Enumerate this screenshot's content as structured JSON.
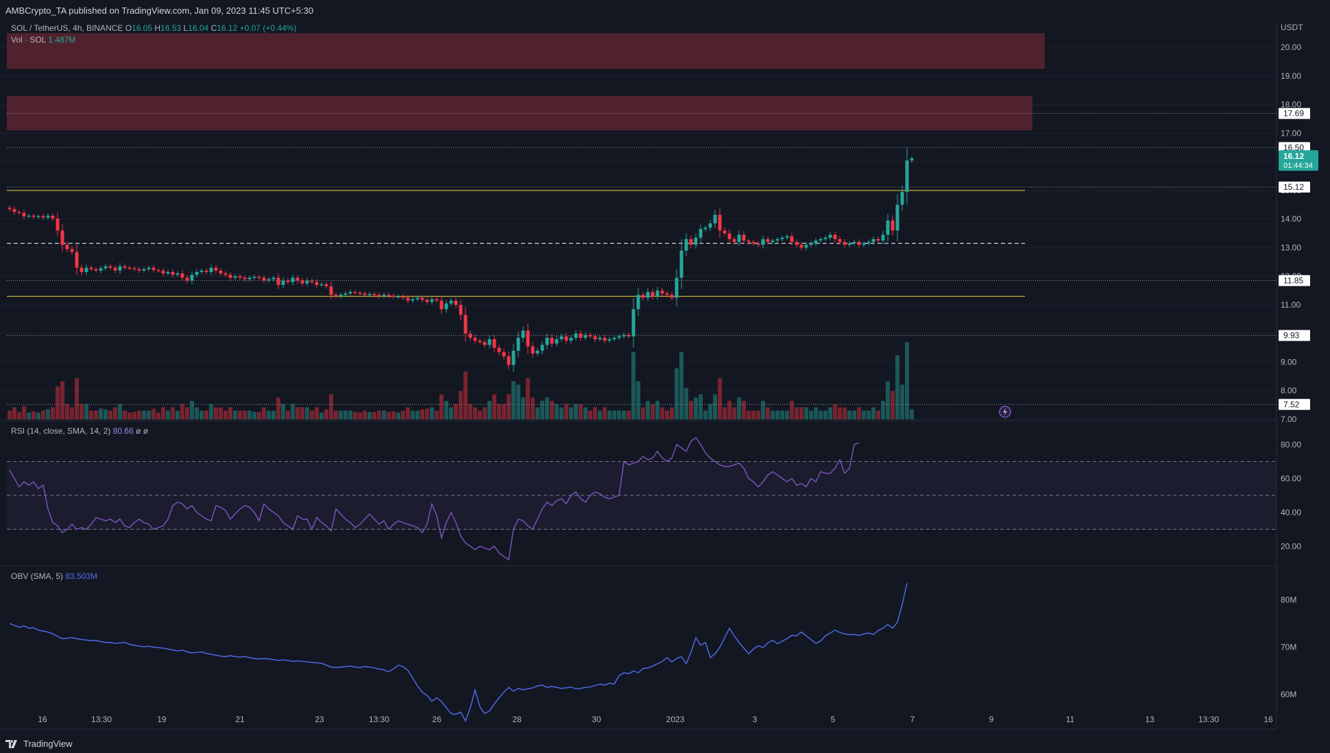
{
  "header": {
    "publisher_line": "AMBCrypto_TA published on TradingView.com, Jan 09, 2023 11:45 UTC+5:30"
  },
  "legend": {
    "symbol": "SOL / TetherUS, 4h, BINANCE",
    "open_label": "O",
    "open": "16.05",
    "high_label": "H",
    "high": "16.53",
    "low_label": "L",
    "low": "16.04",
    "close_label": "C",
    "close": "16.12",
    "change": "+0.07 (+0.44%)",
    "vol_label": "Vol · SOL",
    "vol_value": "1.487M",
    "rsi_label": "RSI (14, close, SMA, 14, 2)",
    "rsi_value": "80.66",
    "rsi_extra": "ø ø",
    "obv_label": "OBV (SMA, 5)",
    "obv_value": "83.503M"
  },
  "footer": {
    "brand": "TradingView"
  },
  "colors": {
    "up": "#26a69a",
    "down": "#f23645",
    "rsi": "#7e57c2",
    "obv": "#4f6ff0",
    "level_yellow": "#c9b23a",
    "zone": "#5c2430",
    "bg": "#131722"
  },
  "chart_data": [
    {
      "type": "candlestick",
      "symbol": "SOL / TetherUS",
      "interval": "4h",
      "currency_label": "USDT",
      "y_ticks": [
        "20.00",
        "19.00",
        "18.00",
        "17.00",
        "16.00",
        "15.00",
        "14.00",
        "13.00",
        "12.00",
        "11.00",
        "10.00",
        "9.00",
        "8.00",
        "7.00"
      ],
      "ylim": [
        7.0,
        20.7
      ],
      "x_ticks": [
        "16",
        "13:30",
        "19",
        "21",
        "23",
        "13:30",
        "26",
        "28",
        "30",
        "2023",
        "3",
        "5",
        "7",
        "9",
        "11",
        "13",
        "13:30",
        "16"
      ],
      "price_labels": [
        {
          "text": "17.69",
          "value": 17.69
        },
        {
          "text": "16.50",
          "value": 16.5
        },
        {
          "text": "15.12",
          "value": 15.12
        },
        {
          "text": "11.85",
          "value": 11.85
        },
        {
          "text": "9.93",
          "value": 9.93
        },
        {
          "text": "7.52",
          "value": 7.52
        }
      ],
      "last_price": {
        "text": "16.12",
        "countdown": "01:44:34",
        "value": 16.12
      },
      "horizontal_levels": [
        {
          "value": 15.0,
          "style": "solid",
          "color": "#c9b23a"
        },
        {
          "value": 11.3,
          "style": "solid",
          "color": "#c9b23a"
        },
        {
          "value": 13.15,
          "style": "dashed",
          "color": "#d1d4dc"
        }
      ],
      "zones": [
        {
          "from": 19.25,
          "to": 20.5,
          "color": "#5c2430"
        },
        {
          "from": 17.1,
          "to": 18.3,
          "color": "#5c2430"
        }
      ],
      "closes": [
        14.35,
        14.25,
        14.22,
        14.1,
        14.12,
        14.08,
        14.1,
        14.05,
        14.12,
        14.02,
        13.6,
        13.1,
        12.95,
        12.85,
        12.3,
        12.15,
        12.3,
        12.25,
        12.2,
        12.28,
        12.35,
        12.3,
        12.2,
        12.35,
        12.3,
        12.28,
        12.25,
        12.2,
        12.25,
        12.3,
        12.22,
        12.2,
        12.1,
        12.15,
        12.05,
        12.1,
        11.95,
        11.85,
        12.05,
        12.15,
        12.2,
        12.15,
        12.3,
        12.2,
        12.1,
        12.05,
        11.95,
        12.0,
        11.95,
        11.9,
        11.95,
        11.98,
        11.95,
        11.85,
        11.9,
        11.95,
        11.7,
        11.85,
        11.8,
        11.95,
        11.85,
        11.75,
        11.85,
        11.8,
        11.7,
        11.72,
        11.65,
        11.35,
        11.3,
        11.35,
        11.4,
        11.45,
        11.42,
        11.4,
        11.35,
        11.38,
        11.35,
        11.3,
        11.35,
        11.32,
        11.28,
        11.3,
        11.25,
        11.15,
        11.2,
        11.25,
        11.18,
        11.1,
        11.2,
        11.15,
        10.85,
        11.05,
        11.15,
        11.0,
        10.65,
        10.0,
        9.85,
        9.75,
        9.7,
        9.6,
        9.8,
        9.5,
        9.35,
        9.2,
        8.9,
        9.4,
        9.85,
        10.1,
        9.55,
        9.3,
        9.4,
        9.6,
        9.85,
        9.65,
        9.8,
        9.9,
        9.75,
        9.85,
        10.0,
        9.85,
        9.95,
        9.9,
        9.8,
        9.85,
        9.75,
        9.8,
        9.85,
        9.9,
        9.95,
        9.9,
        10.85,
        11.35,
        11.25,
        11.45,
        11.3,
        11.5,
        11.4,
        11.35,
        11.25,
        11.95,
        12.9,
        13.3,
        13.1,
        13.35,
        13.65,
        13.7,
        13.85,
        14.15,
        13.6,
        13.5,
        13.3,
        13.2,
        13.45,
        13.25,
        13.2,
        13.15,
        13.1,
        13.3,
        13.2,
        13.25,
        13.3,
        13.35,
        13.4,
        13.2,
        13.1,
        13.0,
        13.1,
        13.15,
        13.25,
        13.3,
        13.35,
        13.45,
        13.3,
        13.2,
        13.1,
        13.15,
        13.2,
        13.1,
        13.15,
        13.2,
        13.3,
        13.25,
        13.45,
        13.95,
        13.6,
        14.5,
        14.95,
        16.05,
        16.12
      ],
      "volume_unit": "M",
      "rsi": {
        "y_ticks": [
          "80.00",
          "60.00",
          "40.00",
          "20.00"
        ],
        "ylim": [
          10,
          90
        ],
        "bands": [
          70,
          50,
          30
        ],
        "values": [
          65,
          60,
          55,
          58,
          56,
          58,
          54,
          56,
          42,
          34,
          32,
          28,
          30,
          33,
          30,
          31,
          30,
          33,
          37,
          36,
          35,
          36,
          34,
          36,
          32,
          31,
          34,
          36,
          34,
          33,
          30,
          31,
          32,
          36,
          44,
          46,
          45,
          42,
          44,
          40,
          38,
          36,
          35,
          44,
          43,
          41,
          36,
          39,
          42,
          44,
          43,
          40,
          35,
          45,
          42,
          40,
          38,
          34,
          32,
          30,
          38,
          36,
          36,
          30,
          37,
          34,
          32,
          29,
          42,
          39,
          36,
          34,
          31,
          33,
          36,
          39,
          36,
          33,
          35,
          30,
          33,
          35,
          34,
          33,
          32,
          31,
          28,
          33,
          45,
          38,
          25,
          34,
          40,
          34,
          26,
          22,
          20,
          18,
          20,
          19,
          18,
          20,
          16,
          14,
          12,
          30,
          36,
          35,
          32,
          30,
          36,
          42,
          46,
          44,
          47,
          48,
          45,
          50,
          52,
          48,
          46,
          50,
          52,
          51,
          49,
          48,
          49,
          50,
          70,
          68,
          69,
          70,
          73,
          71,
          72,
          76,
          72,
          70,
          72,
          80,
          78,
          76,
          82,
          84,
          80,
          75,
          72,
          70,
          68,
          67,
          67,
          68,
          69,
          66,
          60,
          58,
          55,
          58,
          62,
          64,
          62,
          60,
          58,
          60,
          56,
          57,
          55,
          60,
          58,
          64,
          63,
          63,
          66,
          71,
          63,
          66,
          80,
          81
        ]
      },
      "obv": {
        "y_ticks": [
          "80M",
          "70M",
          "60M"
        ],
        "ylim": [
          53,
          86
        ],
        "values": [
          75,
          74.6,
          74.2,
          74.5,
          74.0,
          74.1,
          73.6,
          73.4,
          73.2,
          72.8,
          72.3,
          71.8,
          71.9,
          72.0,
          71.8,
          71.6,
          71.5,
          71.4,
          71.4,
          71.2,
          71.0,
          71.0,
          70.8,
          70.9,
          71.0,
          70.6,
          70.4,
          70.2,
          70.1,
          70.2,
          70.0,
          69.9,
          69.8,
          69.6,
          69.4,
          69.2,
          69.4,
          69.0,
          68.8,
          68.9,
          69.0,
          68.7,
          68.5,
          68.3,
          68.1,
          68.0,
          68.2,
          68.0,
          67.9,
          68.0,
          67.8,
          67.6,
          67.5,
          67.6,
          67.5,
          67.4,
          67.2,
          67.3,
          67.2,
          67.0,
          67.1,
          67.0,
          66.9,
          66.8,
          66.7,
          66.6,
          66.2,
          65.8,
          65.7,
          65.8,
          65.9,
          66.0,
          65.8,
          65.7,
          65.9,
          65.8,
          65.6,
          65.4,
          65.2,
          64.8,
          65.4,
          66.2,
          65.9,
          65.1,
          63.5,
          61.8,
          60.5,
          59.8,
          58.6,
          59.3,
          58.5,
          57.2,
          56.0,
          55.8,
          56.3,
          54.4,
          57.2,
          61.0,
          57.4,
          56.0,
          56.5,
          58.0,
          59.3,
          60.5,
          61.5,
          60.7,
          61.3,
          61.0,
          61.2,
          61.4,
          61.8,
          62.0,
          61.5,
          61.7,
          61.5,
          61.3,
          61.4,
          61.6,
          61.2,
          61.3,
          61.5,
          61.6,
          61.9,
          62.2,
          62.0,
          62.4,
          62.2,
          64.0,
          64.6,
          64.4,
          65.0,
          64.6,
          65.5,
          65.6,
          66.0,
          66.5,
          67.0,
          67.8,
          66.9,
          67.6,
          68.0,
          66.5,
          69.0,
          72.0,
          70.4,
          71.0,
          67.8,
          68.6,
          70.0,
          72.0,
          74.0,
          72.4,
          71.0,
          69.8,
          68.6,
          69.6,
          70.3,
          69.9,
          70.9,
          71.5,
          70.7,
          71.3,
          71.8,
          72.5,
          72.4,
          73.2,
          72.4,
          71.6,
          70.8,
          71.3,
          72.4,
          73.0,
          73.6,
          73.1,
          72.8,
          72.6,
          72.7,
          72.5,
          72.8,
          73.0,
          72.7,
          73.5,
          74.0,
          74.8,
          74.0,
          75.3,
          79.0,
          83.5
        ]
      }
    }
  ]
}
